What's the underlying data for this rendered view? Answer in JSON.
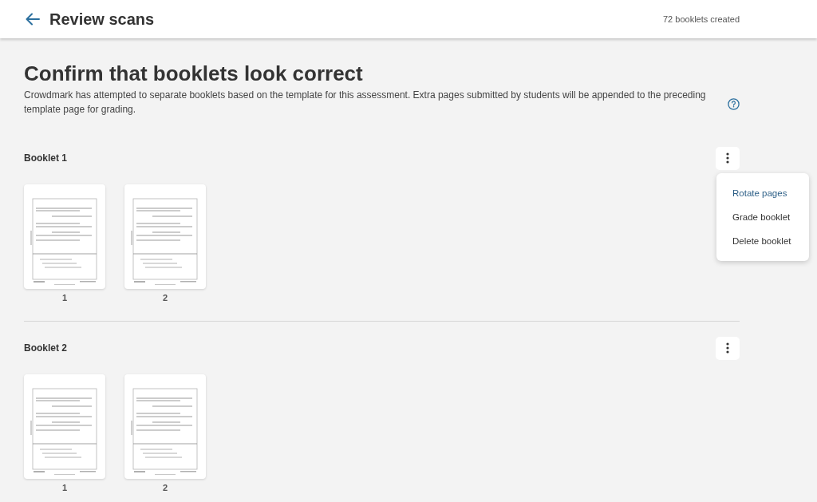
{
  "header": {
    "title": "Review scans",
    "status": "72 booklets created"
  },
  "heading": "Confirm that booklets look correct",
  "description": "Crowdmark has attempted to separate booklets based on the template for this assessment. Extra pages submitted by students will be appended to the preceding template page for grading.",
  "booklets": [
    {
      "label": "Booklet 1",
      "pages": [
        {
          "number": "1"
        },
        {
          "number": "2"
        }
      ],
      "menu": {
        "items": [
          {
            "label": "Rotate pages",
            "selected": true
          },
          {
            "label": "Grade booklet",
            "selected": false
          },
          {
            "label": "Delete booklet",
            "selected": false
          }
        ]
      }
    },
    {
      "label": "Booklet 2",
      "pages": [
        {
          "number": "1"
        },
        {
          "number": "2"
        }
      ]
    }
  ]
}
